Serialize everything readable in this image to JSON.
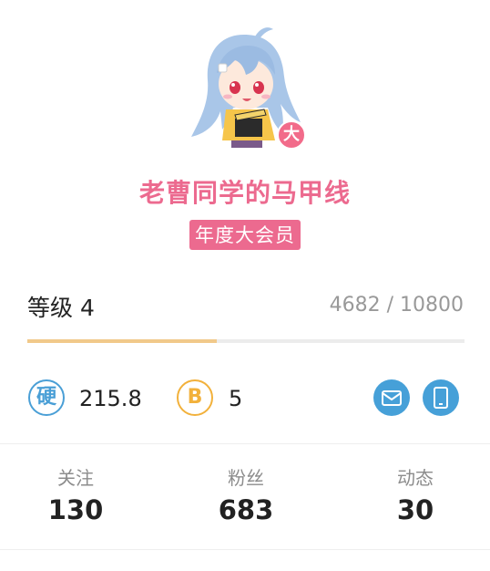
{
  "profile": {
    "username": "老曹同学的马甲线",
    "vip_badge_char": "大",
    "vip_label": "年度大会员"
  },
  "level": {
    "label": "等级 4",
    "exp_text": "4682 / 10800",
    "progress": 0.4335,
    "progress_color": "#f1c98a"
  },
  "wallet": {
    "hard_coin_icon": "硬",
    "hard_coin_value": "215.8",
    "b_coin_icon": "B",
    "b_coin_value": "5"
  },
  "stats": [
    {
      "label": "关注",
      "value": "130"
    },
    {
      "label": "粉丝",
      "value": "683"
    },
    {
      "label": "动态",
      "value": "30"
    }
  ],
  "icons": {
    "hard_coin": "hard-coin-icon",
    "b_coin": "b-coin-icon",
    "mail": "mail-icon",
    "phone": "phone-icon"
  },
  "colors": {
    "accent_pink": "#ec6a8f",
    "accent_blue": "#46a0d8",
    "coin_gold": "#f2b13b"
  }
}
